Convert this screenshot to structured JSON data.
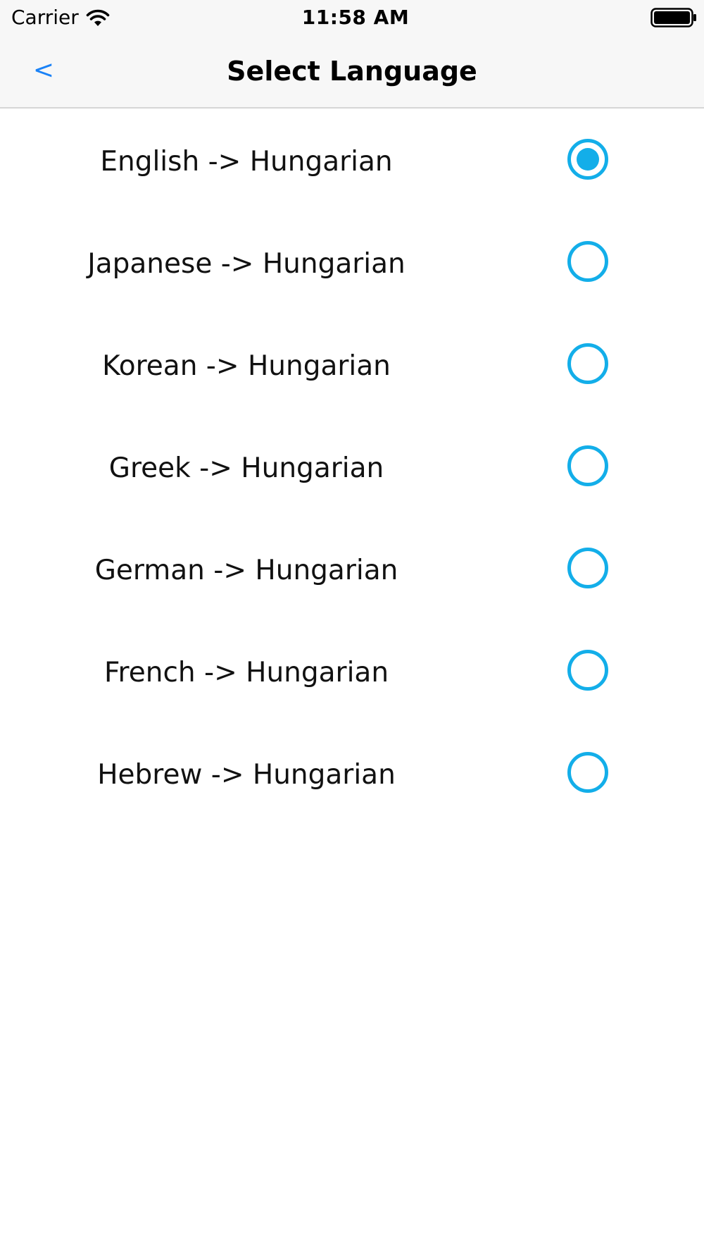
{
  "status_bar": {
    "carrier": "Carrier",
    "time": "11:58 AM",
    "wifi_icon": "wifi-icon",
    "battery_icon": "battery-icon"
  },
  "nav": {
    "back_label": "<",
    "title": "Select Language"
  },
  "accent_color": "#13aee9",
  "link_color": "#1a82f7",
  "languages": [
    {
      "label": "English -> Hungarian",
      "selected": true
    },
    {
      "label": "Japanese -> Hungarian",
      "selected": false
    },
    {
      "label": "Korean -> Hungarian",
      "selected": false
    },
    {
      "label": "Greek -> Hungarian",
      "selected": false
    },
    {
      "label": "German -> Hungarian",
      "selected": false
    },
    {
      "label": "French -> Hungarian",
      "selected": false
    },
    {
      "label": "Hebrew -> Hungarian",
      "selected": false
    }
  ]
}
